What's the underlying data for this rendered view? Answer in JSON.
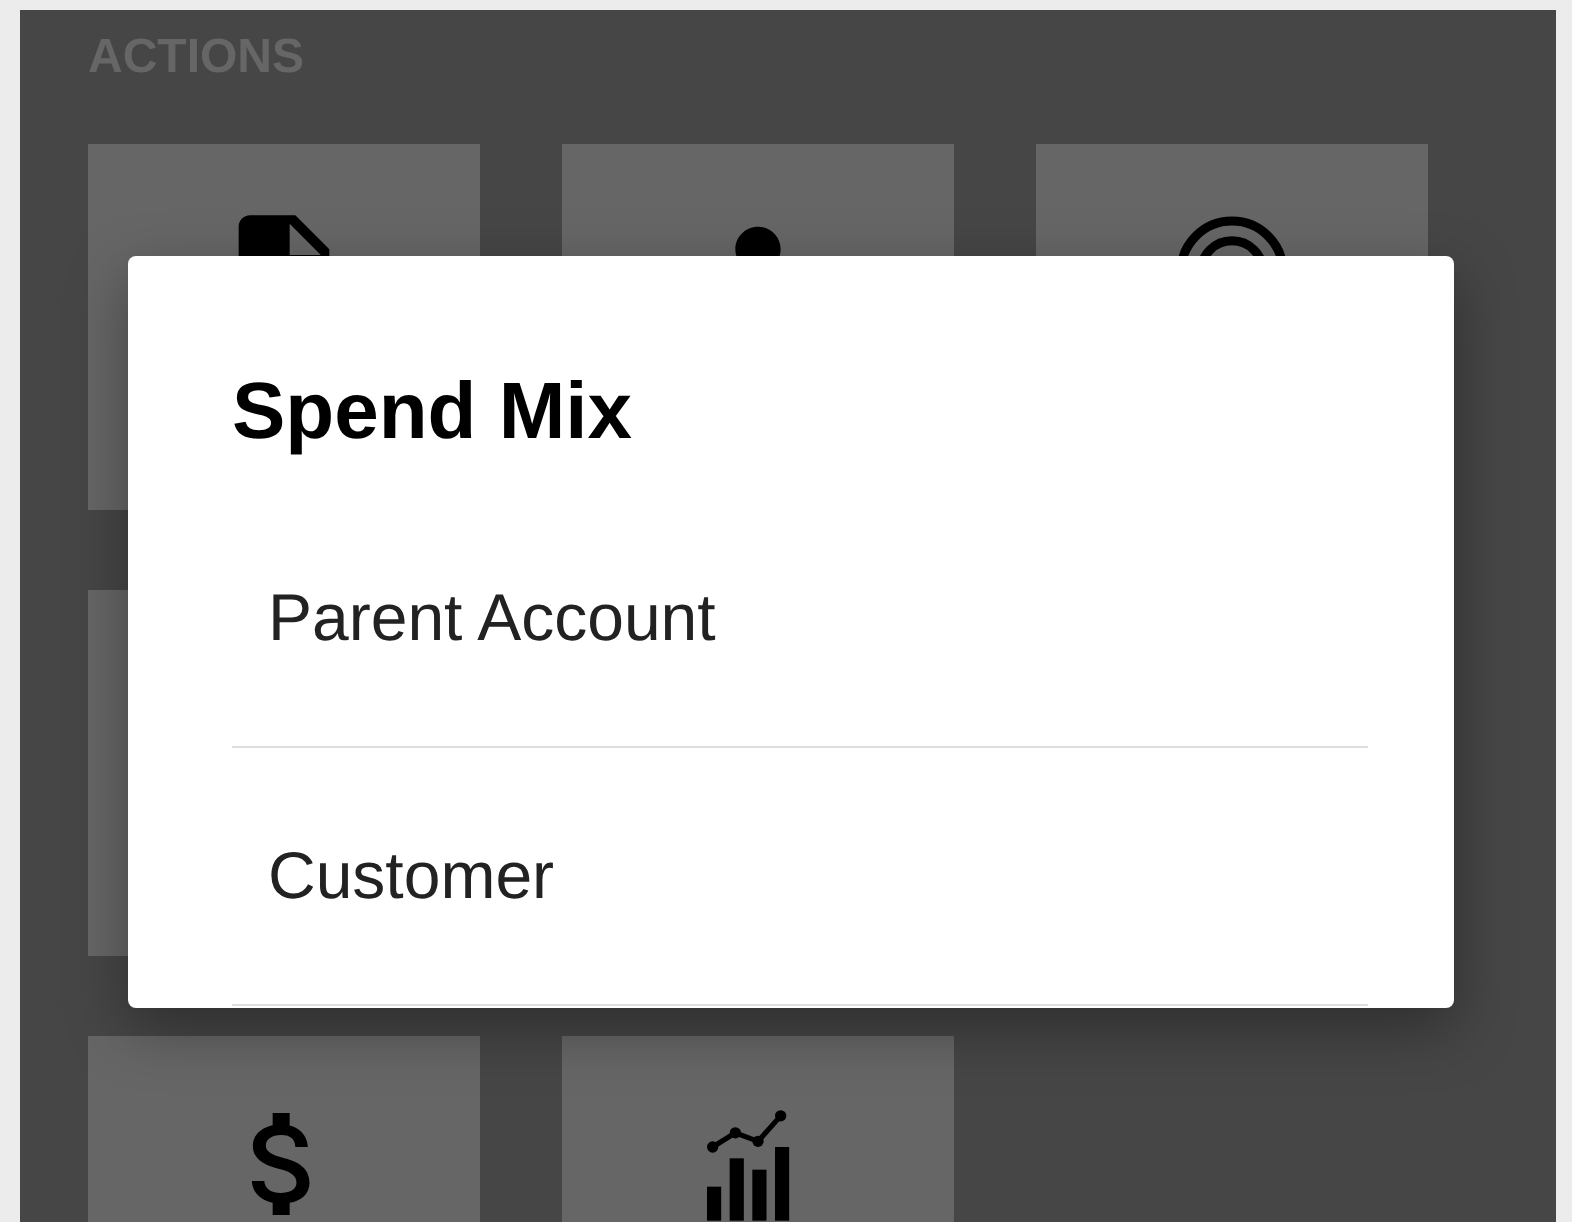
{
  "section_title": "ACTIONS",
  "tile_rows": [
    [
      {
        "kind": "document"
      },
      {
        "kind": "person"
      },
      {
        "kind": "rings"
      }
    ],
    [
      {
        "kind": "blank"
      }
    ],
    [
      {
        "kind": "dollar"
      },
      {
        "kind": "chart"
      }
    ]
  ],
  "dialog": {
    "title": "Spend Mix",
    "options": [
      {
        "label": "Parent Account"
      },
      {
        "label": "Customer"
      }
    ]
  }
}
